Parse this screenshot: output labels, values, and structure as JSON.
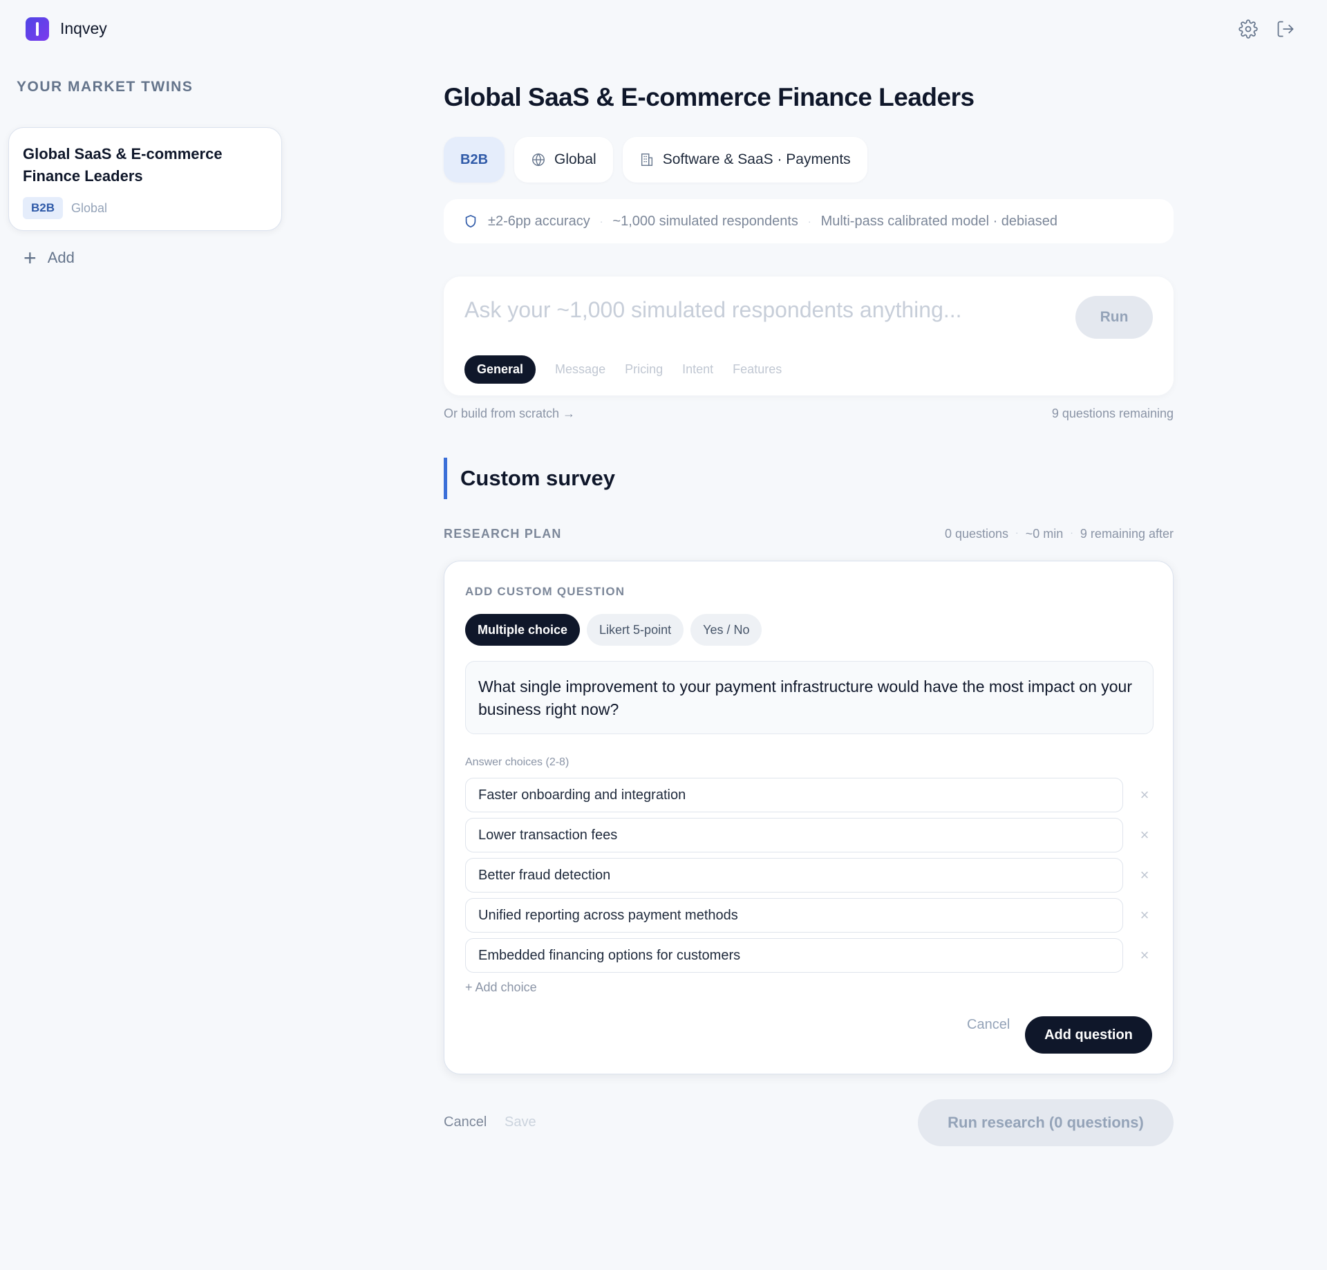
{
  "app": {
    "name": "Inqvey"
  },
  "sidebar": {
    "title": "YOUR MARKET TWINS",
    "twins": [
      {
        "title": "Global SaaS & E-commerce Finance Leaders",
        "type": "B2B",
        "region": "Global"
      }
    ],
    "add_label": "Add"
  },
  "main": {
    "title": "Global SaaS & E-commerce Finance Leaders",
    "chips": {
      "type": "B2B",
      "region": "Global",
      "industry": "Software & SaaS · Payments"
    },
    "accuracy": {
      "accuracy": "±2-6pp accuracy",
      "respondents": "~1,000 simulated respondents",
      "model": "Multi-pass calibrated model · debiased"
    },
    "ask": {
      "placeholder": "Ask your ~1,000 simulated respondents anything...",
      "run_label": "Run",
      "tabs": [
        "General",
        "Message",
        "Pricing",
        "Intent",
        "Features"
      ],
      "active_tab": "General"
    },
    "scratch_link": "Or build from scratch →",
    "questions_remaining": "9 questions remaining",
    "section_title": "Custom survey",
    "plan": {
      "label": "RESEARCH PLAN",
      "questions": "0 questions",
      "duration": "~0 min",
      "remaining_after": "9 remaining after"
    },
    "question_card": {
      "label": "ADD CUSTOM QUESTION",
      "types": [
        "Multiple choice",
        "Likert 5-point",
        "Yes / No"
      ],
      "active_type": "Multiple choice",
      "question_text": "What single improvement to your payment infrastructure would have the most impact on your business right now?",
      "answers_label": "Answer choices (2-8)",
      "choices": [
        "Faster onboarding and integration",
        "Lower transaction fees",
        "Better fraud detection",
        "Unified reporting across payment methods",
        "Embedded financing options for customers"
      ],
      "add_choice_label": "+ Add choice",
      "cancel_label": "Cancel",
      "add_question_label": "Add question"
    },
    "footer": {
      "cancel_label": "Cancel",
      "save_label": "Save",
      "run_research_label": "Run research (0 questions)"
    }
  },
  "icons": {
    "settings": "gear-icon",
    "logout": "logout-icon",
    "globe": "globe-icon",
    "building": "building-icon",
    "shield": "shield-icon",
    "close": "close-icon",
    "plus": "plus-icon"
  },
  "colors": {
    "accent": "#3b6fd8",
    "primary_dark": "#0f172a",
    "b2b_bg": "#e5edfb",
    "b2b_text": "#2f5aa8"
  }
}
